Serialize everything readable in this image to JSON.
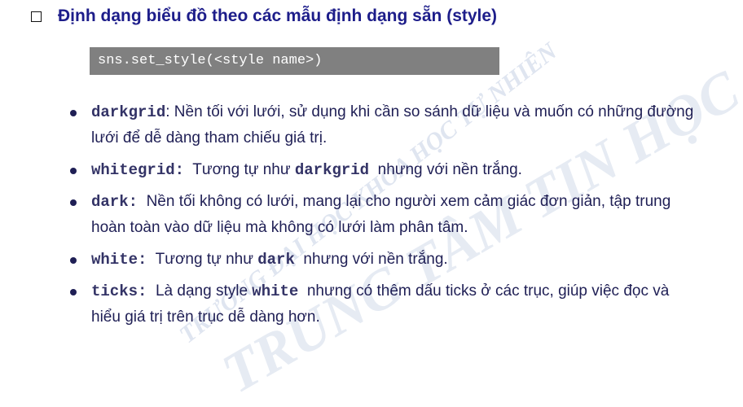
{
  "title": "Định dạng biểu đồ theo các mẫu định dạng sẵn (style)",
  "code": "sns.set_style(<style name>)",
  "items": [
    {
      "keyword": "darkgrid",
      "sep": ":",
      "text": " Nền tối với lưới, sử dụng khi cần so sánh dữ liệu và muốn có những đường lưới để dễ dàng tham chiếu giá trị."
    },
    {
      "keyword": "whitegrid:",
      "sep": "",
      "text": "  Tương tự như ",
      "kw2": "darkgrid",
      "text2": "  nhưng với nền trắng."
    },
    {
      "keyword": "dark:",
      "sep": "",
      "text": "  Nền tối không có lưới, mang lại cho người xem cảm giác đơn giản, tập trung hoàn toàn vào dữ liệu mà không có lưới làm phân tâm."
    },
    {
      "keyword": "white:",
      "sep": "",
      "text": "  Tương tự như ",
      "kw2": "dark",
      "text2": "  nhưng với nền trắng."
    },
    {
      "keyword": "ticks:",
      "sep": "",
      "text": "  Là dạng style ",
      "kw2": "white",
      "text2": "  nhưng có thêm dấu ticks ở các trục, giúp việc đọc và hiểu giá trị trên trục dễ dàng hơn."
    }
  ],
  "watermark": {
    "line1": "TRƯỜNG ĐẠI HỌC KHOA HỌC TỰ NHIÊN",
    "line2": "TRUNG TÂM TIN HỌC"
  }
}
